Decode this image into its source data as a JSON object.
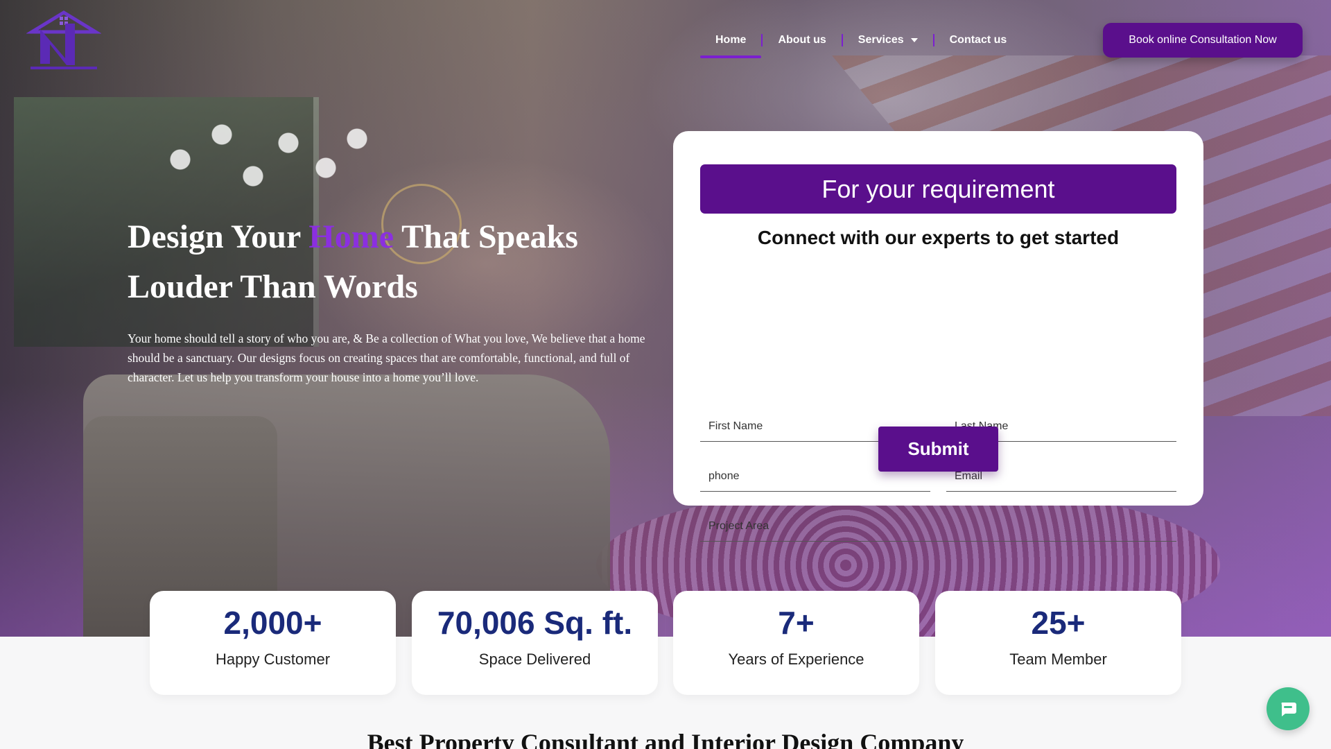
{
  "brand": {
    "logo_icon": "house-letter-n-logo",
    "accent_color": "#5a0f8c",
    "highlight_color": "#8b2fe0"
  },
  "nav": {
    "items": [
      {
        "label": "Home",
        "active": true
      },
      {
        "label": "About us",
        "active": false
      },
      {
        "label": "Services",
        "active": false,
        "has_dropdown": true
      },
      {
        "label": "Contact us",
        "active": false
      }
    ],
    "cta": "Book online Consultation Now"
  },
  "hero": {
    "headline_part1": "Design Your ",
    "headline_accent": "Home",
    "headline_part2": " That Speaks Louder Than Words",
    "paragraph": "Your home should tell a story of who you are, & Be a collection of What you love, We believe that a home should be a sanctuary. Our designs focus on creating spaces that are comfortable, functional, and full of character. Let us help you transform your house into a home you’ll love."
  },
  "form": {
    "title": "For your requirement",
    "subtitle": "Connect with our experts to get started",
    "first_name_placeholder": "First Name",
    "last_name_placeholder": "Last Name",
    "phone_placeholder": "phone",
    "email_placeholder": "Email",
    "project_area_placeholder": "Project Area",
    "submit": "Submit"
  },
  "stats": [
    {
      "value": "2,000+",
      "label": "Happy Customer"
    },
    {
      "value": "70,006 Sq. ft.",
      "label": "Space Delivered"
    },
    {
      "value": "7+",
      "label": "Years of Experience"
    },
    {
      "value": "25+",
      "label": "Team Member"
    }
  ],
  "section_title": "Best Property Consultant and Interior Design Company",
  "chat": {
    "icon": "chat-bubble-icon",
    "color": "#3fbf8b"
  }
}
